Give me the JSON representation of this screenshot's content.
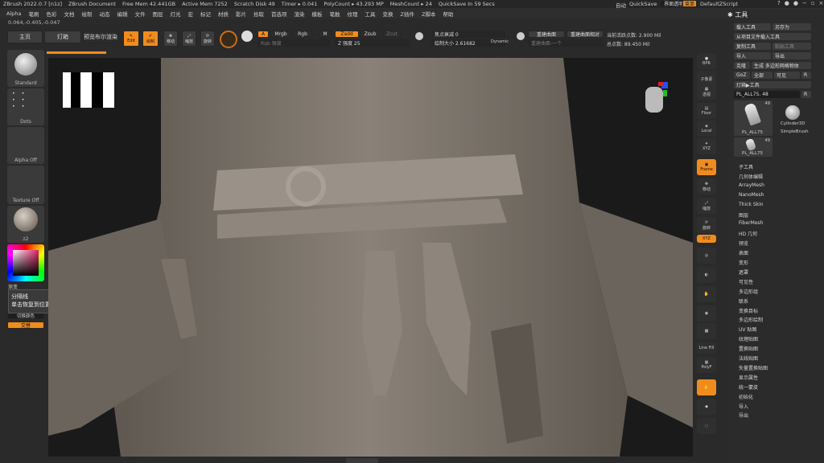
{
  "titlebar": {
    "app": "ZBrush 2022.0.7 [n1z]",
    "doc": "ZBrush Document",
    "free_mem": "Free Mem 42.441GB",
    "active_mem": "Active Mem 7252",
    "scratch": "Scratch Disk 49",
    "timer": "Timer ▸ 0.041",
    "polycount": "PolyCount ▸ 43.293 MP",
    "meshcount": "MeshCount ▸ 24",
    "quicksave": "QuickSave In 59 Secs",
    "auto": "自动",
    "quicksave_btn": "QuickSave",
    "transparency": "界面透明 0",
    "menus": "菜单",
    "script": "DefaultZScript"
  },
  "menubar": [
    "Alpha",
    "笔刷",
    "色彩",
    "文档",
    "绘制",
    "动态",
    "编辑",
    "文件",
    "图层",
    "灯光",
    "宏",
    "标记",
    "材质",
    "影片",
    "拾取",
    "首选项",
    "渲染",
    "模板",
    "笔触",
    "纹理",
    "工具",
    "变换",
    "Z插件",
    "Z脚本",
    "帮助"
  ],
  "coords": "0.064,-0.405,-0.047",
  "top": {
    "home": "主页",
    "lightbox": "灯箱",
    "preview_render": "预览布尔渲染",
    "edit": "Edit",
    "draw": "绘制",
    "move": "移动",
    "scale": "缩放",
    "rotate": "旋转",
    "a": "A",
    "mrgb": "Mrgb",
    "rgb": "Rgb",
    "m": "M",
    "zadd": "Zadd",
    "zsub": "Zsub",
    "zcut": "Zcut",
    "rgb_intensity": "Rgb 强度",
    "z_intensity": "Z 强度 25",
    "focal_shift": "焦点衰减 0",
    "draw_size": "绘制大小 2.61682",
    "dynamic": "Dynamic",
    "symmetry": "重建曲面",
    "symmetry2": "重建曲面相对",
    "stroke_prev": "重建曲面-一个",
    "active_points": "当前活跃点数: 2.900 Mil",
    "total_points": "总点数: 89.450 Mil"
  },
  "left": {
    "standard": "Standard",
    "dots": "Dots",
    "alpha_off": "Alpha Off",
    "texture_off": "Texture Off",
    "material": "z2",
    "gradient": "渐变",
    "switch_color": "切换颜色",
    "alternate": "交替"
  },
  "tooltip": {
    "title": "分隔线",
    "body": "单击恢复到位置。"
  },
  "right_shelf": [
    "BPR",
    "子像素",
    "透视",
    "地面",
    "Floor",
    "Local",
    "XYZ",
    "Frame",
    "移动",
    "缩放",
    "旋转",
    "Line Fill",
    "PolyF",
    "透明",
    "Ghost",
    "Solo",
    "Xpose",
    "Dynamic",
    "Spotlight"
  ],
  "tool": {
    "header": "工具",
    "load": "载入工具",
    "save_as": "另存为",
    "import_file": "从项目文件载入工具",
    "copy": "复制工具",
    "paste": "粘贴工具",
    "import": "导入",
    "export": "导出",
    "clone": "克隆",
    "make_polymesh": "生成 多边形网格物体",
    "goz": "GoZ",
    "all": "全部",
    "visible": "可见",
    "r": "R",
    "lightbox_tool": "灯箱▶工具",
    "current": "PL_ALL75. 48",
    "count1": "49",
    "count2": "49",
    "thumb1": "PL_ALL75",
    "thumb2": "Cylinder3D",
    "thumb3": "SimpleBrush",
    "thumb4": "PL_ALL75",
    "menu": [
      "子工具",
      "几何体编辑",
      "ArrayMesh",
      "NanoMesh",
      "Thick Skin",
      "图层",
      "FiberMesh",
      "HD 几何",
      "预览",
      "表面",
      "变形",
      "遮罩",
      "可见性",
      "多边形组",
      "联系",
      "变换目标",
      "多边形绘制",
      "UV 贴图",
      "纹理贴图",
      "置换贴图",
      "法线贴图",
      "矢量置换贴图",
      "显示属性",
      "统一蒙皮",
      "初始化",
      "导入",
      "导出"
    ]
  },
  "colors": {
    "accent": "#f08c1e",
    "panel": "#2b2b2b",
    "viewport": "#1a1a1a"
  }
}
